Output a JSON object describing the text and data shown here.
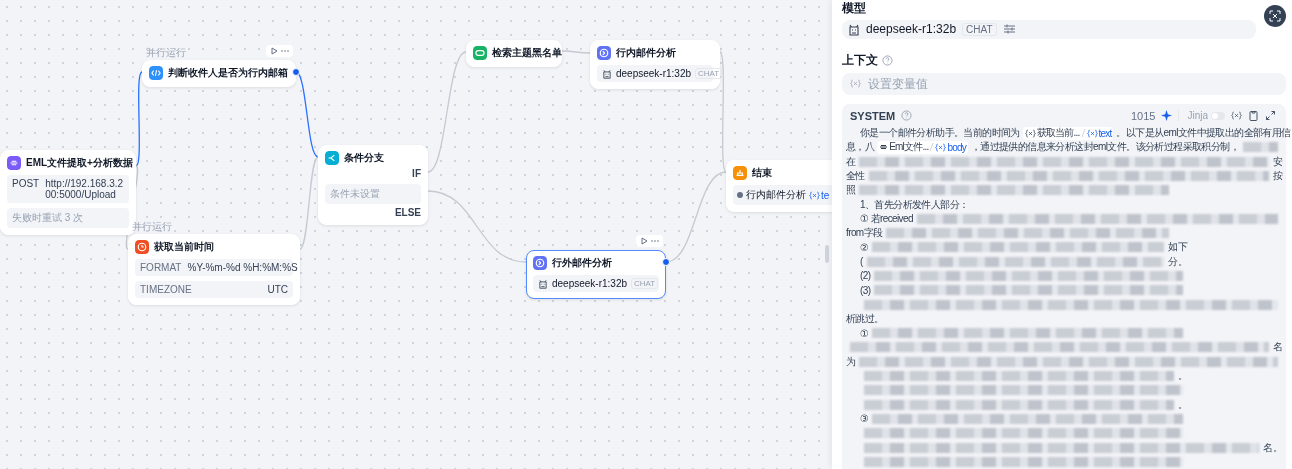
{
  "canvas": {
    "nodes": [
      {
        "kind": "start",
        "title": "EML文件提取+分析数据",
        "selected": false,
        "method": "POST",
        "url": "http://192.168.3.200:5000/Upload",
        "footer": "失败时重试 3 次"
      },
      {
        "kind": "code",
        "title": "判断收件人是否为行内邮箱",
        "badge": "并行运行",
        "selected": false,
        "toolbar": true
      },
      {
        "kind": "tool",
        "title": "获取当前时间",
        "badge": "并行运行",
        "selected": false,
        "rows": [
          {
            "key": "FORMAT",
            "value": "%Y-%m-%d %H:%M:%S"
          },
          {
            "key": "TIMEZONE",
            "value": "UTC"
          }
        ]
      },
      {
        "kind": "if",
        "title": "条件分支",
        "selected": false,
        "if_label": "IF",
        "note": "条件未设置",
        "else_label": "ELSE"
      },
      {
        "kind": "knowledge",
        "title": "检索主题黑名单",
        "selected": false
      },
      {
        "kind": "llm",
        "title": "行内邮件分析",
        "selected": false,
        "model": "deepseek-r1:32b",
        "mode": "CHAT"
      },
      {
        "kind": "llm",
        "title": "行外邮件分析",
        "selected": true,
        "toolbar": true,
        "model": "deepseek-r1:32b",
        "mode": "CHAT"
      },
      {
        "kind": "end",
        "title": "结束",
        "selected": false,
        "output_node": "行内邮件分析",
        "output_var": "te"
      }
    ],
    "edges": [
      {
        "highlighted": true
      },
      {
        "highlighted": true
      },
      {
        "highlighted": false
      },
      {
        "highlighted": false
      },
      {
        "highlighted": false
      },
      {
        "highlighted": false
      },
      {
        "highlighted": false
      },
      {
        "highlighted": false
      },
      {
        "highlighted": false
      }
    ]
  },
  "panel": {
    "model_label": "模型",
    "model": {
      "name": "deepseek-r1:32b",
      "mode": "CHAT"
    },
    "context_label": "上下文",
    "context_placeholder": "设置变量值",
    "system": {
      "title": "SYSTEM",
      "count": "1015",
      "jinja": {
        "label": "Jinja",
        "on": false
      },
      "lines": [
        {
          "indent": true,
          "full": true,
          "segments": [
            {
              "kind": "text",
              "text": "你是一个邮件分析助手。当前的时间为"
            },
            {
              "kind": "tool_chip",
              "source": "获取当前...",
              "var": "text"
            },
            {
              "kind": "text",
              "text": "。以下是从eml文件中提取出的全部有用信"
            }
          ]
        },
        {
          "indent": false,
          "full": true,
          "segments": [
            {
              "kind": "text",
              "text": "息，八"
            },
            {
              "kind": "start_chip",
              "source": "Eml文件...",
              "var": "body"
            },
            {
              "kind": "text",
              "text": "，通过提供的信息来分析这封eml文件。该分析过程采取积分制，"
            },
            {
              "kind": "redacted"
            }
          ]
        },
        {
          "indent": false,
          "full": true,
          "segments": [
            {
              "kind": "text",
              "text": "在"
            },
            {
              "kind": "redacted"
            },
            {
              "kind": "text",
              "text": "安"
            }
          ]
        },
        {
          "indent": false,
          "full": true,
          "segments": [
            {
              "kind": "text",
              "text": "全性"
            },
            {
              "kind": "redacted"
            },
            {
              "kind": "text",
              "text": "按"
            }
          ]
        },
        {
          "indent": false,
          "full": false,
          "segments": [
            {
              "kind": "text",
              "text": "照"
            },
            {
              "kind": "redacted"
            }
          ]
        },
        {
          "indent": true,
          "full": false,
          "segments": [
            {
              "kind": "text",
              "text": "1、首先分析发件人部分："
            }
          ]
        },
        {
          "indent": true,
          "full": true,
          "segments": [
            {
              "kind": "text",
              "text": "① 若received"
            },
            {
              "kind": "redacted"
            }
          ]
        },
        {
          "indent": false,
          "full": false,
          "segments": [
            {
              "kind": "text",
              "text": "from字段"
            },
            {
              "kind": "redacted"
            }
          ]
        },
        {
          "indent": true,
          "full": false,
          "segments": [
            {
              "kind": "text",
              "text": "②"
            },
            {
              "kind": "redacted"
            },
            {
              "kind": "text",
              "text": "如下"
            }
          ]
        },
        {
          "indent": true,
          "full": false,
          "segments": [
            {
              "kind": "text",
              "text": "("
            },
            {
              "kind": "redacted"
            },
            {
              "kind": "text",
              "text": "分。"
            }
          ]
        },
        {
          "indent": true,
          "full": false,
          "segments": [
            {
              "kind": "text",
              "text": "(2)"
            },
            {
              "kind": "redacted"
            }
          ]
        },
        {
          "indent": true,
          "full": false,
          "segments": [
            {
              "kind": "text",
              "text": "(3)"
            },
            {
              "kind": "redacted"
            }
          ]
        },
        {
          "indent": true,
          "full": true,
          "segments": [
            {
              "kind": "redacted"
            }
          ]
        },
        {
          "indent": false,
          "full": false,
          "segments": [
            {
              "kind": "text",
              "text": "析跳过。"
            }
          ]
        },
        {
          "indent": true,
          "full": false,
          "segments": [
            {
              "kind": "text",
              "text": "①"
            },
            {
              "kind": "redacted"
            }
          ]
        },
        {
          "indent": false,
          "full": true,
          "segments": [
            {
              "kind": "redacted"
            },
            {
              "kind": "text",
              "text": "名"
            }
          ]
        },
        {
          "indent": false,
          "full": true,
          "segments": [
            {
              "kind": "text",
              "text": "为"
            },
            {
              "kind": "redacted"
            }
          ]
        },
        {
          "indent": true,
          "full": false,
          "segments": [
            {
              "kind": "redacted"
            },
            {
              "kind": "text",
              "text": "。"
            }
          ]
        },
        {
          "indent": true,
          "full": false,
          "segments": [
            {
              "kind": "redacted"
            }
          ]
        },
        {
          "indent": true,
          "full": false,
          "segments": [
            {
              "kind": "redacted"
            },
            {
              "kind": "text",
              "text": "。"
            }
          ]
        },
        {
          "indent": true,
          "full": false,
          "segments": [
            {
              "kind": "text",
              "text": "③"
            },
            {
              "kind": "redacted"
            }
          ]
        },
        {
          "indent": true,
          "full": false,
          "segments": [
            {
              "kind": "redacted"
            }
          ]
        },
        {
          "indent": true,
          "full": true,
          "segments": [
            {
              "kind": "redacted"
            },
            {
              "kind": "text",
              "text": "名。"
            }
          ]
        },
        {
          "indent": true,
          "full": false,
          "segments": [
            {
              "kind": "redacted"
            }
          ]
        }
      ]
    }
  }
}
